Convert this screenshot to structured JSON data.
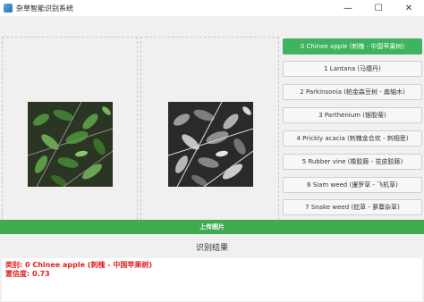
{
  "window": {
    "title": "杂草智能识别系统",
    "controls": {
      "minimize": "—",
      "maximize": "☐",
      "close": "✕"
    }
  },
  "buttons": [
    {
      "label": "0 Chinee apple (刺槐 - 中国苹果树)",
      "active": true
    },
    {
      "label": "1 Lantana (马缨丹)",
      "active": false
    },
    {
      "label": "2 Parkinsonia (帕金森豆树 - 扁轴木)",
      "active": false
    },
    {
      "label": "3 Parthenium (银胶菊)",
      "active": false
    },
    {
      "label": "4 Prickly acacia (刺槐金合欢 - 刺相思)",
      "active": false
    },
    {
      "label": "5 Rubber vine (橡胶藤 - 花皮胶藤)",
      "active": false
    },
    {
      "label": "6 Siam weed (暹罗草 - 飞机草)",
      "active": false
    },
    {
      "label": "7 Snake weed (蛇草 - 萝藦杂草)",
      "active": false
    }
  ],
  "upload": {
    "label": "上传图片"
  },
  "result": {
    "title": "识别结果",
    "class_line": "类别: 0 Chinee apple (刺槐 - 中国苹果树)",
    "confidence_line": "置信度: 0.73"
  },
  "colors": {
    "accent": "#3fb35f",
    "result_text": "#e02020"
  }
}
